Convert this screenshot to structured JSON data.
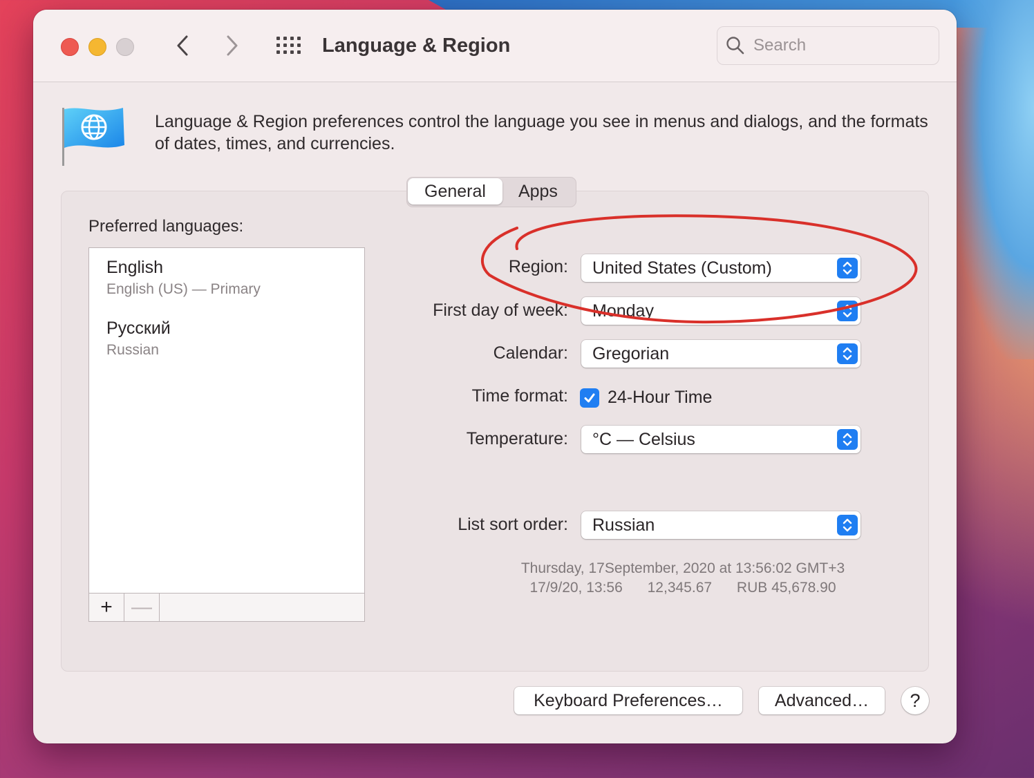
{
  "window": {
    "title": "Language & Region"
  },
  "search": {
    "placeholder": "Search"
  },
  "description": "Language & Region preferences control the language you see in menus and dialogs, and the formats of dates, times, and currencies.",
  "tabs": [
    {
      "label": "General",
      "selected": true
    },
    {
      "label": "Apps",
      "selected": false
    }
  ],
  "preferred_languages": {
    "label": "Preferred languages:",
    "items": [
      {
        "name": "English",
        "detail": "English (US) — Primary"
      },
      {
        "name": "Русский",
        "detail": "Russian"
      }
    ],
    "add_label": "+",
    "remove_label": "—"
  },
  "settings": {
    "region": {
      "label": "Region:",
      "value": "United States (Custom)"
    },
    "first_day": {
      "label": "First day of week:",
      "value": "Monday"
    },
    "calendar": {
      "label": "Calendar:",
      "value": "Gregorian"
    },
    "time_format": {
      "label": "Time format:",
      "checkbox_label": "24-Hour Time",
      "checked": true
    },
    "temperature": {
      "label": "Temperature:",
      "value": "°C — Celsius"
    },
    "list_sort": {
      "label": "List sort order:",
      "value": "Russian"
    }
  },
  "sample": {
    "line1": "Thursday, 17September, 2020 at 13:56:02 GMT+3",
    "short_date": "17/9/20, 13:56",
    "number": "12,345.67",
    "currency": "RUB 45,678.90"
  },
  "buttons": {
    "keyboard": "Keyboard Preferences…",
    "advanced": "Advanced…",
    "help": "?"
  },
  "colors": {
    "accent": "#1f7ef2",
    "annotation": "#d9302a",
    "close": "#ee5a52",
    "minimize": "#f5b731"
  },
  "icons": [
    "back-chevron-icon",
    "forward-chevron-icon",
    "grid-icon",
    "search-icon",
    "globe-flag-icon",
    "stepper-arrows-icon",
    "checkmark-icon"
  ]
}
